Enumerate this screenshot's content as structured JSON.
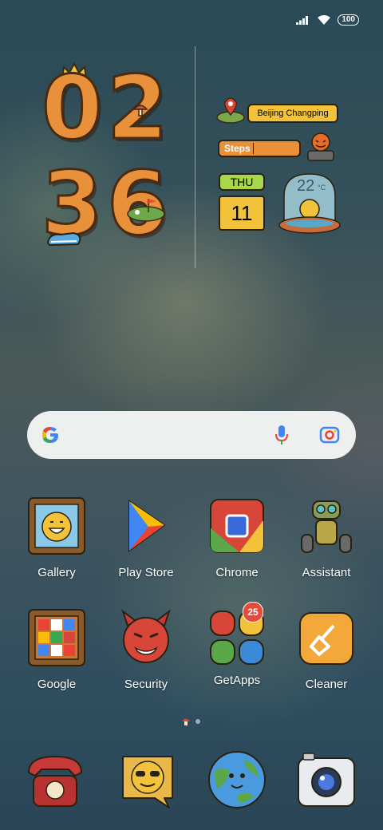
{
  "status_bar": {
    "battery": "100"
  },
  "clock": {
    "hour_1": "0",
    "hour_2": "2",
    "minute_1": "3",
    "minute_2": "6"
  },
  "widget": {
    "location": "Beijing Changping",
    "steps_label": "Steps",
    "day": "THU",
    "date": "11",
    "temperature": "22",
    "temperature_unit": "°C"
  },
  "apps": [
    {
      "label": "Gallery"
    },
    {
      "label": "Play Store"
    },
    {
      "label": "Chrome"
    },
    {
      "label": "Assistant"
    },
    {
      "label": "Google"
    },
    {
      "label": "Security"
    },
    {
      "label": "GetApps",
      "badge": "25"
    },
    {
      "label": "Cleaner"
    }
  ],
  "colors": {
    "accent_orange": "#e8913a",
    "widget_yellow": "#f2c23a",
    "badge_red": "#e84a3a"
  }
}
